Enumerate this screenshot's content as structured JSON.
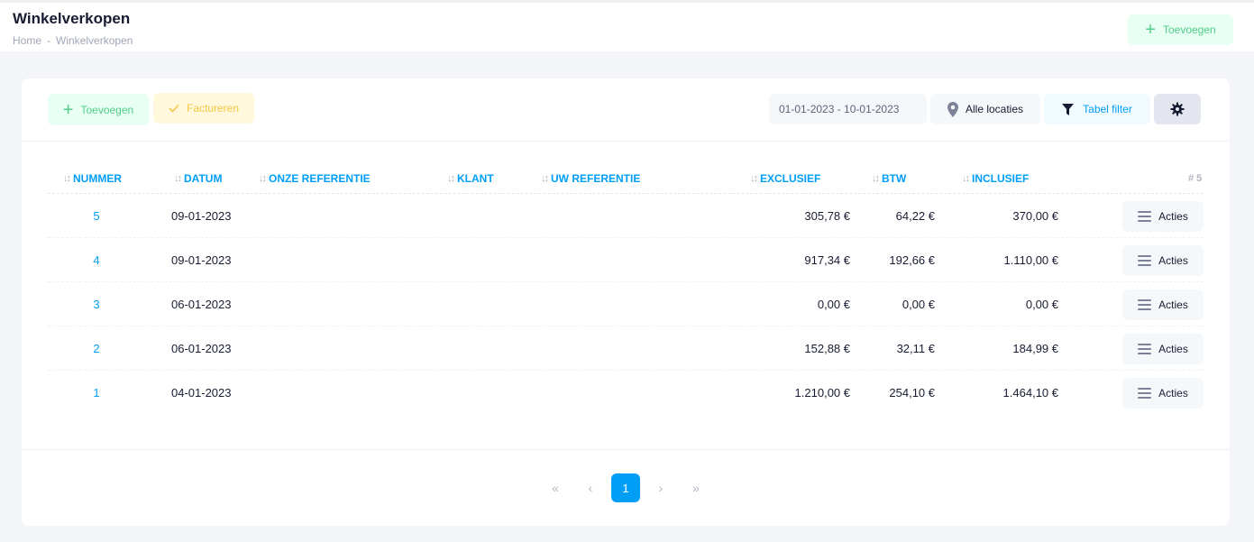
{
  "header": {
    "title": "Winkelverkopen",
    "breadcrumb": [
      "Home",
      "Winkelverkopen"
    ],
    "breadcrumb_sep": "-",
    "add_label": "Toevoegen"
  },
  "toolbar": {
    "add_label": "Toevoegen",
    "bill_label": "Factureren",
    "date_range": "01-01-2023 - 10-01-2023",
    "location_label": "Alle locaties",
    "filter_label": "Tabel filter"
  },
  "table": {
    "columns": [
      "NUMMER",
      "DATUM",
      "ONZE REFERENTIE",
      "KLANT",
      "UW REFERENTIE",
      "EXCLUSIEF",
      "BTW",
      "INCLUSIEF"
    ],
    "count_label": "# 5",
    "rows": [
      {
        "nummer": "5",
        "datum": "09-01-2023",
        "exclusief": "305,78 €",
        "btw": "64,22 €",
        "inclusief": "370,00 €",
        "action": "Acties"
      },
      {
        "nummer": "4",
        "datum": "09-01-2023",
        "exclusief": "917,34 €",
        "btw": "192,66 €",
        "inclusief": "1.110,00 €",
        "action": "Acties"
      },
      {
        "nummer": "3",
        "datum": "06-01-2023",
        "exclusief": "0,00 €",
        "btw": "0,00 €",
        "inclusief": "0,00 €",
        "action": "Acties"
      },
      {
        "nummer": "2",
        "datum": "06-01-2023",
        "exclusief": "152,88 €",
        "btw": "32,11 €",
        "inclusief": "184,99 €",
        "action": "Acties"
      },
      {
        "nummer": "1",
        "datum": "04-01-2023",
        "exclusief": "1.210,00 €",
        "btw": "254,10 €",
        "inclusief": "1.464,10 €",
        "action": "Acties"
      }
    ]
  },
  "pagination": {
    "first": "«",
    "prev": "‹",
    "current": "1",
    "next": "›",
    "last": "»"
  },
  "colors": {
    "primary": "#009ef7",
    "success": "#50cd89",
    "warning": "#f5c842",
    "muted": "#b5b5c3"
  }
}
